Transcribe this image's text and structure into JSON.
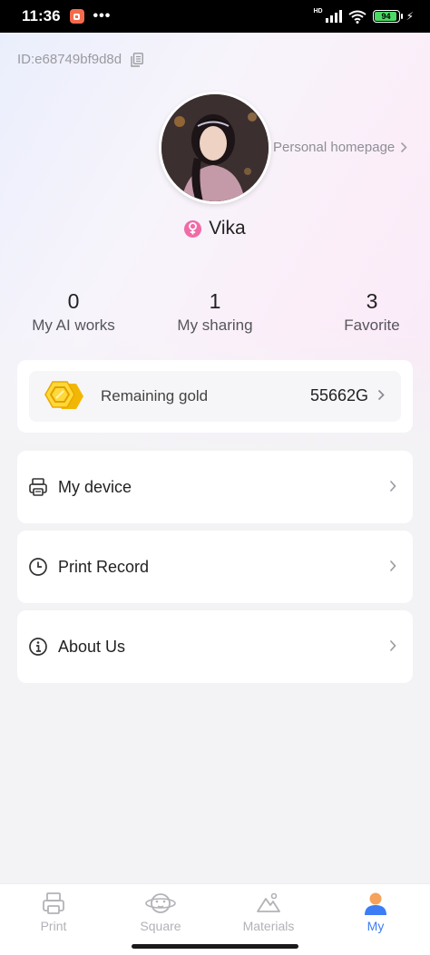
{
  "status_bar": {
    "time": "11:36",
    "dots": "•••",
    "network_label": "HD",
    "battery_level": "94",
    "battery_percent": 94
  },
  "profile": {
    "user_id": "ID:e68749bf9d8d",
    "homepage_link": "Personal homepage",
    "username": "Vika",
    "gender": "female"
  },
  "stats": [
    {
      "value": "0",
      "label": "My AI works"
    },
    {
      "value": "1",
      "label": "My sharing"
    },
    {
      "value": "3",
      "label": "Favorite"
    }
  ],
  "gold": {
    "label": "Remaining gold",
    "value": "55662G"
  },
  "menu": {
    "device": {
      "label": "My device",
      "icon": "printer-icon"
    },
    "print_record": {
      "label": "Print Record",
      "icon": "clock-icon"
    },
    "about": {
      "label": "About Us",
      "icon": "info-icon"
    }
  },
  "bottom_nav": [
    {
      "label": "Print",
      "icon": "printer-icon",
      "active": false
    },
    {
      "label": "Square",
      "icon": "planet-icon",
      "active": false
    },
    {
      "label": "Materials",
      "icon": "mountain-icon",
      "active": false
    },
    {
      "label": "My",
      "icon": "person-icon",
      "active": true
    }
  ],
  "colors": {
    "accent": "#3c7cf5",
    "gender_female": "#f06ba6",
    "gold": "#f5c518",
    "inactive_nav": "#b2b2b8"
  }
}
